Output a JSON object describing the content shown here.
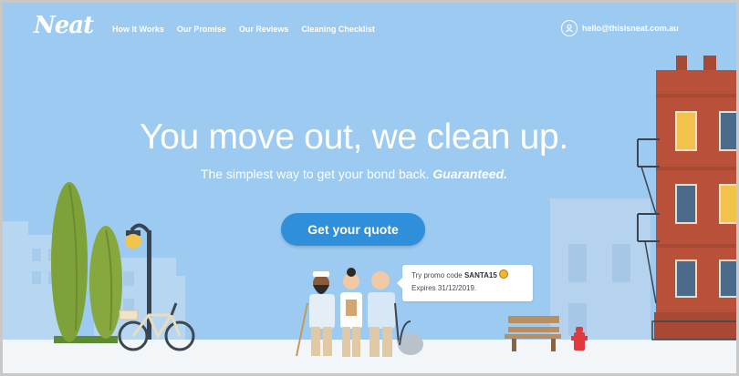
{
  "brand": {
    "logo_text": "Neat"
  },
  "nav": {
    "items": [
      {
        "label": "How It Works"
      },
      {
        "label": "Our Promise"
      },
      {
        "label": "Our Reviews"
      },
      {
        "label": "Cleaning Checklist"
      }
    ]
  },
  "contact": {
    "icon": "user-circle-icon",
    "email": "hello@thisisneat.com.au"
  },
  "hero": {
    "headline": "You move out, we clean up.",
    "subline": "The simplest way to get your bond back.",
    "subline_emphasis": "Guaranteed.",
    "cta_label": "Get your quote"
  },
  "promo": {
    "prefix": "Try promo code",
    "code": "SANTA15",
    "emoji": "grinning-emoji",
    "expiry": "Expires 31/12/2019."
  },
  "colors": {
    "sky": "#9ccaf0",
    "cta": "#2f8fdb",
    "brick": "#b9503a",
    "tree": "#7fa13a"
  }
}
